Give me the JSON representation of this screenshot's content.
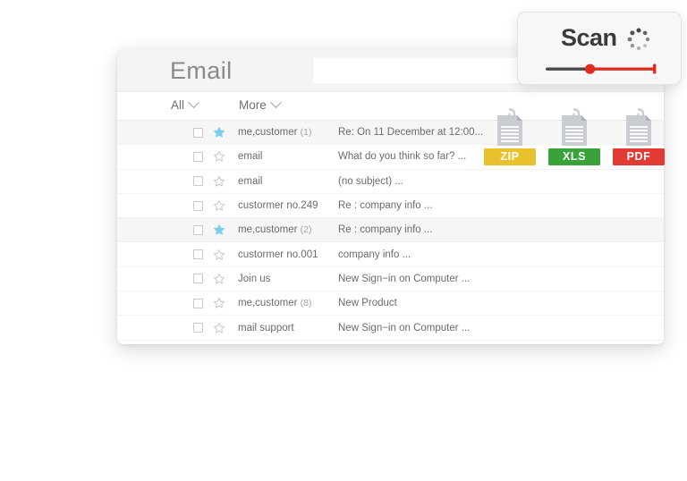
{
  "window": {
    "title": "Email",
    "search": {
      "value": "",
      "placeholder": ""
    },
    "toolbar": {
      "all_label": "All",
      "more_label": "More",
      "chevron_icon": "chevron-down-icon"
    }
  },
  "mail_rows": [
    {
      "sender": "me,customer",
      "count": "(1)",
      "subject": "Re: On 11 December at 12:00...",
      "starred": true,
      "selected": true
    },
    {
      "sender": "email",
      "count": "",
      "subject": "What do you think so far? ...",
      "starred": false,
      "selected": false
    },
    {
      "sender": "email",
      "count": "",
      "subject": "(no subject) ...",
      "starred": false,
      "selected": false
    },
    {
      "sender": "custormer no.249",
      "count": "",
      "subject": "Re : company info ...",
      "starred": false,
      "selected": false
    },
    {
      "sender": "me,customer",
      "count": "(2)",
      "subject": "Re : company info ...",
      "starred": true,
      "selected": true
    },
    {
      "sender": "custormer no.001",
      "count": "",
      "subject": "company info ...",
      "starred": false,
      "selected": false
    },
    {
      "sender": "Join us",
      "count": "",
      "subject": "New Sign−in on Computer ...",
      "starred": false,
      "selected": false
    },
    {
      "sender": "me,customer",
      "count": "(8)",
      "subject": "New Product",
      "starred": false,
      "selected": false
    },
    {
      "sender": "mail support",
      "count": "",
      "subject": "New Sign−in on Computer ...",
      "starred": false,
      "selected": false
    }
  ],
  "badges": [
    {
      "label": "ZIP",
      "color": "#e8c22e",
      "icon": "document-icon"
    },
    {
      "label": "XLS",
      "color": "#3aa23a",
      "icon": "document-icon"
    },
    {
      "label": "PDF",
      "color": "#e23b34",
      "icon": "document-icon"
    }
  ],
  "scan_card": {
    "title": "Scan",
    "spinner_icon": "loading-spinner-icon",
    "slider": {
      "value_percent": 40,
      "track_left_color": "#4a4a4e",
      "track_right_color": "#e02b20",
      "knob_color": "#e02b20"
    }
  },
  "colors": {
    "header_bg": "#f4f4f4",
    "row_selected_bg": "#f6f6f6",
    "star_active": "#7ecfef",
    "star_inactive": "#c4c4c4",
    "text": "#6b6b6b"
  }
}
